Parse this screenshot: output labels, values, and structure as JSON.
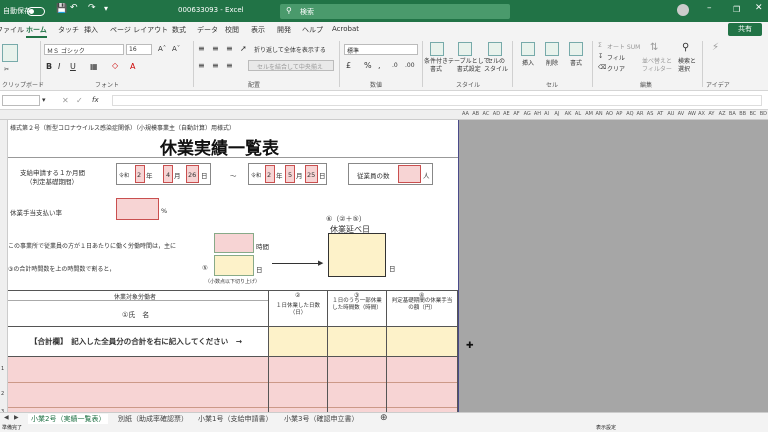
{
  "titlebar": {
    "autosave_label": "自動保存",
    "autosave_state": "オフ",
    "file_title": "000633093 - Excel",
    "search_placeholder": "検索"
  },
  "tabs": [
    "ファイル",
    "ホーム",
    "タッチ",
    "挿入",
    "ページ レイアウト",
    "数式",
    "データ",
    "校閲",
    "表示",
    "開発",
    "ヘルプ",
    "Acrobat"
  ],
  "share_label": "共有",
  "ribbon": {
    "font_name": "ＭＳ ゴシック",
    "font_size": "16",
    "wrap_label": "折り返して全体を表示する",
    "merge_label": "セルを結合して中央揃え",
    "number_format": "標準",
    "style_buttons": [
      "条件付き\n書式",
      "テーブルとして\n書式設定",
      "セルの\nスタイル"
    ],
    "cell_buttons": [
      "挿入",
      "削除",
      "書式"
    ],
    "edit_items": [
      "オート SUM",
      "フィル",
      "クリア"
    ],
    "sort_label": "並べ替えと\nフィルター",
    "find_label": "検索と\n選択",
    "idea_label": "アイデア",
    "groups": [
      "クリップボード",
      "フォント",
      "配置",
      "数値",
      "スタイル",
      "セル",
      "編集",
      "アイデア"
    ]
  },
  "formula_bar": {
    "cell_ref": "",
    "content": ""
  },
  "grey_cols": [
    "AA",
    "AB",
    "AC",
    "AD",
    "AE",
    "AF",
    "AG",
    "AH",
    "AI",
    "AJ",
    "AK",
    "AL",
    "AM",
    "AN",
    "AO",
    "AP",
    "AQ",
    "AR",
    "AS",
    "AT",
    "AU",
    "AV",
    "AW",
    "AX",
    "AY",
    "AZ",
    "BA",
    "BB",
    "BC",
    "BD"
  ],
  "sheet": {
    "form_header": "様式第２号（新型コロナウイルス感染症関係）（小規模事業主（自動計算）用様式）",
    "main_title": "休業実績一覧表",
    "period_label_1": "支給申請する１か月間",
    "period_label_2": "（判定基礎期間）",
    "era_1": "令和",
    "year_1": "2",
    "year_unit_1": "年",
    "month_1": "4",
    "month_unit_1": "月",
    "day_1": "26",
    "day_unit_1": "日",
    "tilde": "〜",
    "era_2": "令和",
    "year_2": "2",
    "year_unit_2": "年",
    "month_2": "5",
    "month_unit_2": "月",
    "day_2": "25",
    "day_unit_2": "日",
    "employees_label": "従業員の数",
    "employees_unit": "人",
    "rate_label": "休業手当支払い率",
    "rate_unit": "%",
    "hours_text": "この事業所で従業員の方が１日あたりに働く労働時間は，主に",
    "hours_unit": "時間",
    "ratio_text": "③の合計時間数を上の時間数で割ると，",
    "marker_5": "⑤",
    "days_unit": "日",
    "round_note": "（小数点以下切り上げ）",
    "formula_header": "⑥（②＋⑤）",
    "total_days_label": "休業延べ日",
    "total_days_unit": "日",
    "col_target": "休業対象労働者",
    "col_name": "①氏　名",
    "col2_num": "②",
    "col2_text": "１日休業した日数（日）",
    "col3_num": "③",
    "col3_text": "１日のうち一部休業した時間数（時間）",
    "col4_num": "④",
    "col4_text": "判定基礎期間の休業手当の額（円）",
    "total_row_label": "【合計欄】　記入した全員分の合計を右に記入してください　→",
    "row_numbers": [
      "1",
      "2",
      "3"
    ]
  },
  "sheet_tabs": [
    "小業2号（実績一覧表）",
    "別紙（助成率確認票）",
    "小業1号（支給申請書）",
    "小業3号（確認申立書）"
  ],
  "status": {
    "ready": "準備完了",
    "display_settings": "表示設定"
  }
}
